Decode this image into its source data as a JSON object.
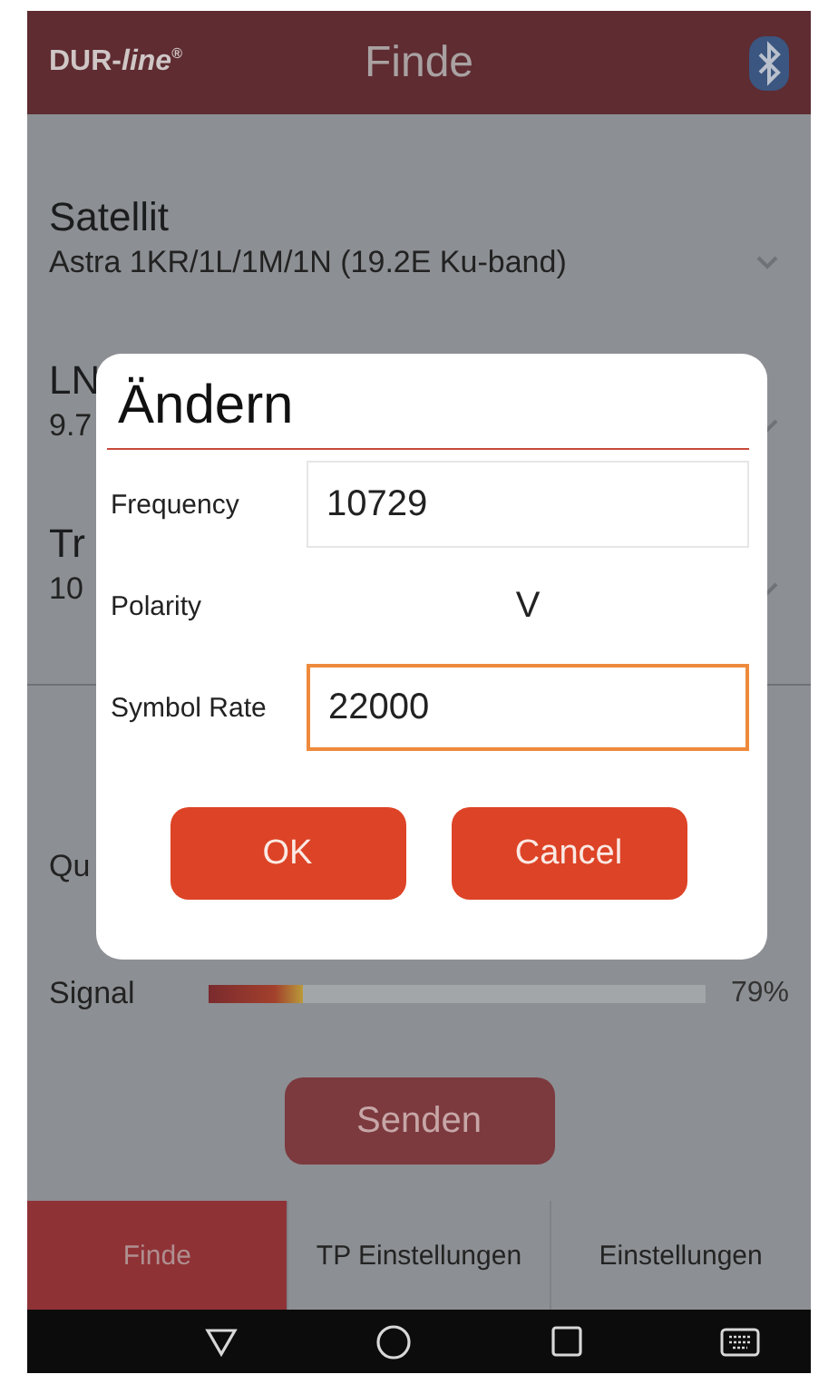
{
  "app_bar": {
    "logo": "DUR-*line*$^{®}$",
    "title": "Finde"
  },
  "settings": [
    {
      "label": "Satellit",
      "value": "Astra 1KR/1L/1M/1N (19.2E Ku-band)"
    },
    {
      "label": "LN",
      "value": "9.7"
    },
    {
      "label": "Tr",
      "value": "10"
    }
  ],
  "meters": [
    {
      "label": "Qu"
    },
    {
      "label": "Signal",
      "level": 0.19,
      "reading": "79%"
    }
  ],
  "send_button": "Senden",
  "tabs": [
    {
      "label": "Finde",
      "selected": true
    },
    {
      "label": "TP Einstellungen",
      "selected": false
    },
    {
      "label": "Einstellungen",
      "selected": false
    }
  ],
  "dialog": {
    "title": "Ändern",
    "fields": [
      {
        "kind": "input",
        "label": "Frequency",
        "value": "10729",
        "focused": false
      },
      {
        "kind": "text",
        "label": "Polarity",
        "value": "V"
      },
      {
        "kind": "input",
        "label": "Symbol Rate",
        "value": "22000",
        "focused": true
      }
    ],
    "buttons": [
      "OK",
      "Cancel"
    ]
  }
}
